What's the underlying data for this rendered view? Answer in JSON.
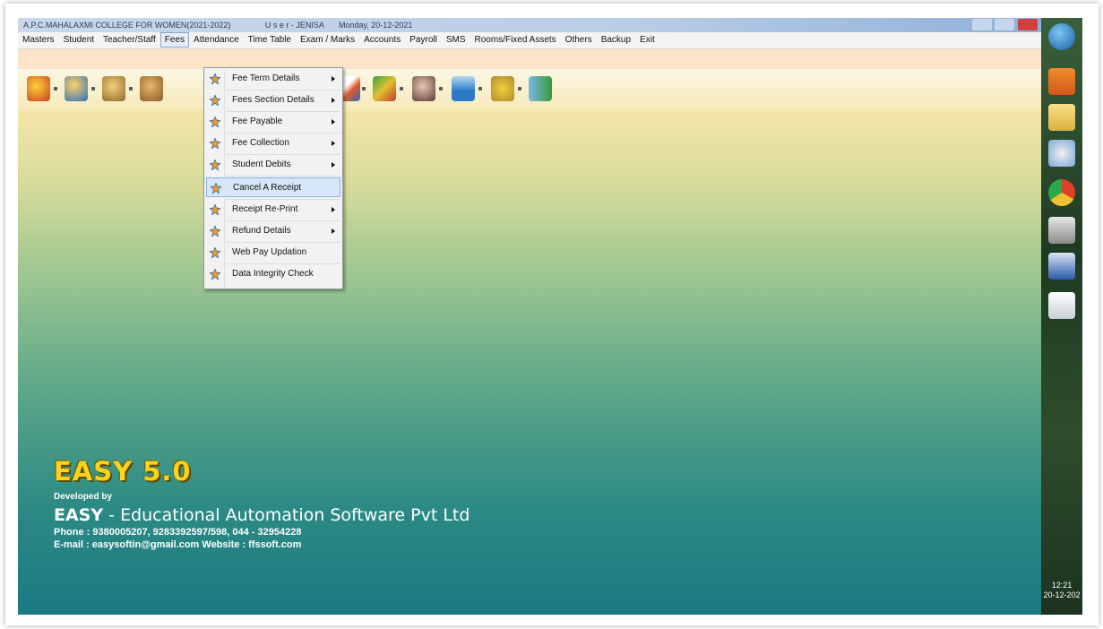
{
  "window": {
    "title": "A.P.C.MAHALAXMI COLLEGE FOR WOMEN(2021-2022)",
    "user": "U s e r - JENISA",
    "date": "Monday, 20-12-2021"
  },
  "menubar": {
    "items": [
      {
        "label": "Masters"
      },
      {
        "label": "Student"
      },
      {
        "label": "Teacher/Staff"
      },
      {
        "label": "Fees"
      },
      {
        "label": "Attendance"
      },
      {
        "label": "Time Table"
      },
      {
        "label": "Exam / Marks"
      },
      {
        "label": "Accounts"
      },
      {
        "label": "Payroll"
      },
      {
        "label": "SMS"
      },
      {
        "label": "Rooms/Fixed Assets"
      },
      {
        "label": "Others"
      },
      {
        "label": "Backup"
      },
      {
        "label": "Exit"
      }
    ],
    "open_menu": "Fees"
  },
  "fees_menu": {
    "items": [
      {
        "label": "Fee Term Details",
        "submenu": true
      },
      {
        "label": "Fees Section Details",
        "submenu": true
      },
      {
        "label": "Fee Payable",
        "submenu": true
      },
      {
        "label": "Fee Collection",
        "submenu": true
      },
      {
        "label": "Student Debits",
        "submenu": true
      },
      {
        "label": "Cancel A Receipt",
        "submenu": false,
        "highlighted": true
      },
      {
        "label": "Receipt Re-Print",
        "submenu": true
      },
      {
        "label": "Refund Details",
        "submenu": true
      },
      {
        "label": "Web Pay Updation",
        "submenu": false
      },
      {
        "label": "Data Integrity Check",
        "submenu": false
      }
    ]
  },
  "toolbar": {
    "icons": [
      "gift-icon",
      "users-icon",
      "students-icon",
      "hand-icon",
      "pencil-icon",
      "books-icon",
      "teacher-icon",
      "chart-icon",
      "tools-icon",
      "exit-door-icon"
    ]
  },
  "branding": {
    "product": "EASY 5.0",
    "developed_by": "Developed by",
    "company_bold": "EASY",
    "company_rest": " - Educational Automation Software Pvt Ltd",
    "phone": "Phone : 9380005207, 9283392597/598,  044 - 32954228",
    "email_line": "E-mail : easysoftin@gmail.com     Website : ffssoft.com"
  },
  "taskbar": {
    "icons": [
      "start-orb-icon",
      "outlook-icon",
      "folder-icon",
      "paint-icon",
      "chrome-icon",
      "scanner-icon",
      "word-icon",
      "document-icon"
    ],
    "time": "12:21",
    "date": "20-12-202"
  },
  "colors": {
    "menu_highlight": "#d7e6f8",
    "brand_yellow": "#ffd21a",
    "desktop_top": "#f4e6a8",
    "desktop_bottom": "#1a7a82"
  }
}
